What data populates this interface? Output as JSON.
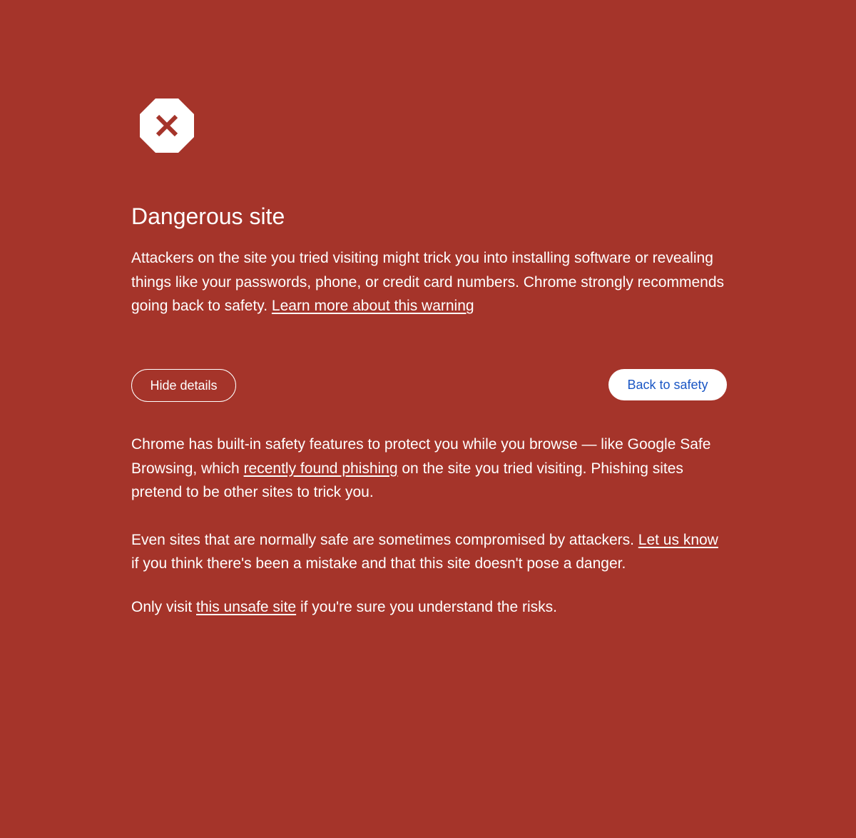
{
  "theme": {
    "background": "#a5342a",
    "text": "#ffffff",
    "primary_button_text": "#1a56c4"
  },
  "icon": {
    "name": "dangerous-site-octagon-icon"
  },
  "heading": "Dangerous site",
  "main_message": {
    "text": "Attackers on the site you tried visiting might trick you into installing software or revealing things like your passwords, phone, or credit card numbers. Chrome strongly recommends going back to safety. ",
    "learn_more_link": "Learn more about this warning"
  },
  "buttons": {
    "hide_details": "Hide details",
    "back_to_safety": "Back to safety"
  },
  "details": {
    "paragraph1": {
      "before": "Chrome has built-in safety features to protect you while you browse — like Google Safe Browsing, which ",
      "link": "recently found phishing",
      "after": " on the site you tried visiting. Phishing sites pretend to be other sites to trick you."
    },
    "paragraph2": {
      "before": "Even sites that are normally safe are sometimes compromised by attackers. ",
      "link": "Let us know",
      "after": " if you think there's been a mistake and that this site doesn't pose a danger."
    },
    "paragraph3": {
      "before": "Only visit ",
      "link": "this unsafe site",
      "after": " if you're sure you understand the risks."
    }
  }
}
